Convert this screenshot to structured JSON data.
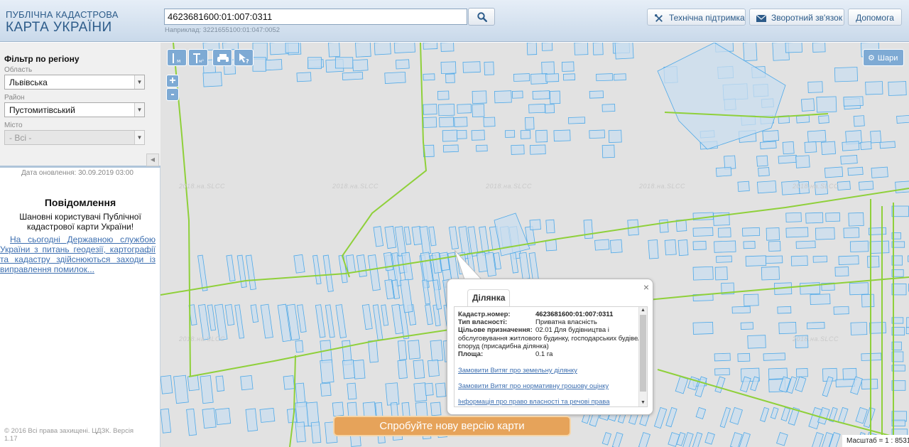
{
  "header": {
    "logo_line1": "ПУБЛІЧНА КАДАСТРОВА",
    "logo_line2": "КАРТА УКРАЇНИ",
    "search_value": "4623681600:01:007:0311",
    "search_hint": "Наприклад: 3221655100:01:047:0052",
    "support_label": "Технічна підтримка",
    "feedback_label": "Зворотний зв'язок",
    "help_label": "Допомога"
  },
  "sidebar": {
    "filter_title": "Фільтр по регіону",
    "region_label": "Область",
    "region_value": "Львівська",
    "district_label": "Район",
    "district_value": "Пустомитівський",
    "city_label": "Місто",
    "city_value": "- Всі -",
    "update_date": "Дата оновлення: 30.09.2019 03:00",
    "notice_title": "Повідомлення",
    "notice_greeting": "Шановні користувачі Публічної кадастрової карти України!",
    "notice_text": "На сьогодні Державною службою України з питань геодезії, картографії та кадастру здійснюються заходи із виправлення помилок...",
    "copyright": "© 2016 Всі права захищені. ЦДЗК. Версія 1.17"
  },
  "map": {
    "layers_label": "Шари",
    "watermark": "2018.на.SLCC",
    "zoom_in": "+",
    "zoom_out": "-",
    "scale_text": "Масштаб = 1 : 8531",
    "new_version_label": "Спробуйте нову версію карти"
  },
  "popup": {
    "tab_label": "Ділянка",
    "close": "×",
    "cadastral_key": "Кадастр.номер:",
    "cadastral_value": "4623681600:01:007:0311",
    "ownership_key": "Тип власності:",
    "ownership_value": "Приватна власність",
    "purpose_key": "Цільове призначення:",
    "purpose_value_1": "02.01 Для будівництва і",
    "purpose_value_2": "обслуговування житлового будинку, господарських будівель і",
    "purpose_value_3": "споруд (присадибна ділянка)",
    "area_key": "Площа:",
    "area_value": "0.1 га",
    "link_extract": "Замовити Витяг про земельну ділянку",
    "link_valuation": "Замовити Витяг про нормативну грошову оцінку",
    "link_rights": "Інформація про право власності та речові права"
  },
  "colors": {
    "parcel_fill": "#c9ddef",
    "parcel_stroke": "#4fa9e8",
    "boundary": "#8fd03a",
    "map_bg": "#e2e2e2",
    "accent": "#2d5c8a",
    "new_version_bg": "#e6a35a"
  }
}
